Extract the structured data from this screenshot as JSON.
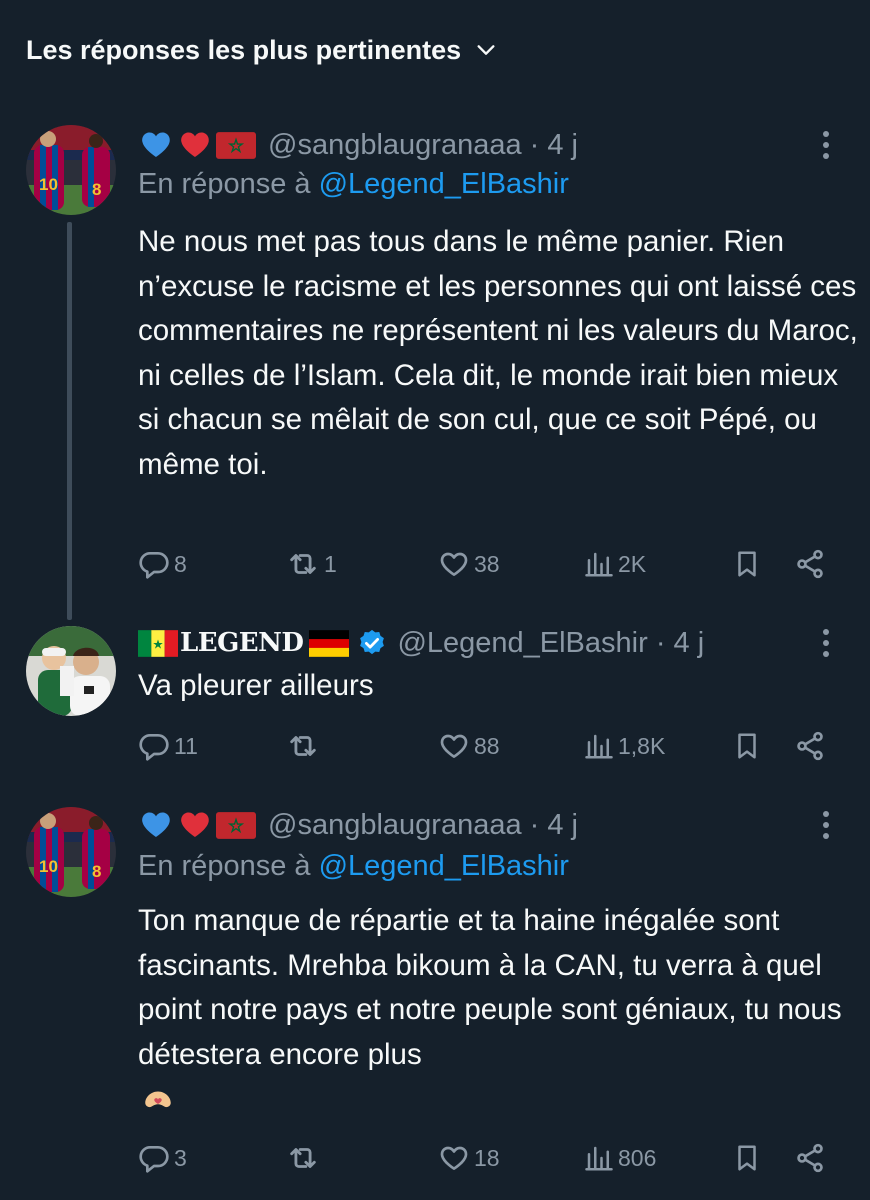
{
  "header": {
    "title": "Les réponses les plus pertinentes",
    "chevron_icon": "chevron-down-icon"
  },
  "colors": {
    "background": "#15202b",
    "link": "#1d9bf0",
    "muted": "#8b98a5",
    "text": "#f7f9f9",
    "verified": "#1d9bf0"
  },
  "tweets": [
    {
      "handle": "@sangblaugranaaa",
      "time": "· 4 j",
      "reply_prefix": "En réponse à",
      "reply_to": "@Legend_ElBashir",
      "text": "Ne nous met pas tous dans le même panier. Rien n’excuse le racisme et les personnes qui ont laissé ces commentaires ne représentent ni les valeurs du Maroc, ni celles de l’Islam. Cela dit, le monde irait bien mieux si chacun se mêlait de son cul, que ce soit Pépé, ou même toi.",
      "replies": "8",
      "reposts": "1",
      "likes": "38",
      "views": "2K"
    },
    {
      "name": "LEGEND",
      "handle": "@Legend_ElBashir",
      "time": "· 4 j",
      "text": "Va pleurer ailleurs",
      "replies": "11",
      "reposts": "",
      "likes": "88",
      "views": "1,8K"
    },
    {
      "handle": "@sangblaugranaaa",
      "time": "· 4 j",
      "reply_prefix": "En réponse à",
      "reply_to": "@Legend_ElBashir",
      "text": "Ton manque de répartie et ta haine inégalée sont fascinants. Mrehba bikoum à la CAN, tu verra à quel point notre pays et notre peuple sont géniaux, tu nous détestera encore plus",
      "replies": "3",
      "reposts": "",
      "likes": "18",
      "views": "806"
    }
  ]
}
